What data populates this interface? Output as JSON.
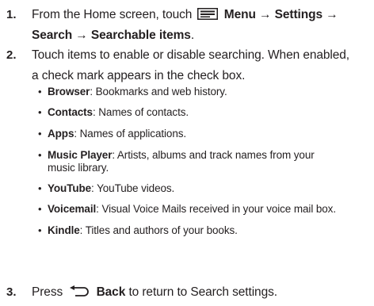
{
  "steps": [
    {
      "num": "1.",
      "line1_prefix": "From the Home screen, touch",
      "menu_icon": "menu-icon",
      "menu_path": "Menu → Settings →",
      "line2": "Search → Searchable items",
      "line2_end": "."
    },
    {
      "num": "2.",
      "line1": "Touch items to enable or disable searching. When enabled,",
      "line2": "a check mark appears in the check box."
    },
    {
      "num": "3.",
      "prefix": "Press",
      "back_icon": "back-icon",
      "back_label": "Back",
      "suffix": "to return to Search settings."
    }
  ],
  "items": [
    {
      "label": "Browser",
      "desc": ": Bookmarks and web history."
    },
    {
      "label": "Contacts",
      "desc": ": Names of contacts."
    },
    {
      "label": "Apps",
      "desc": ": Names of applications."
    },
    {
      "label": "Music Player",
      "desc": ": Artists, albums and track names from your music library."
    },
    {
      "label": "YouTube",
      "desc": ": YouTube videos."
    },
    {
      "label": "Voicemail",
      "desc": ": Visual Voice Mails received in your voice mail box."
    },
    {
      "label": "Kindle",
      "desc": ": Titles and authors of your books."
    }
  ],
  "colors": {
    "text": "#231f20"
  }
}
